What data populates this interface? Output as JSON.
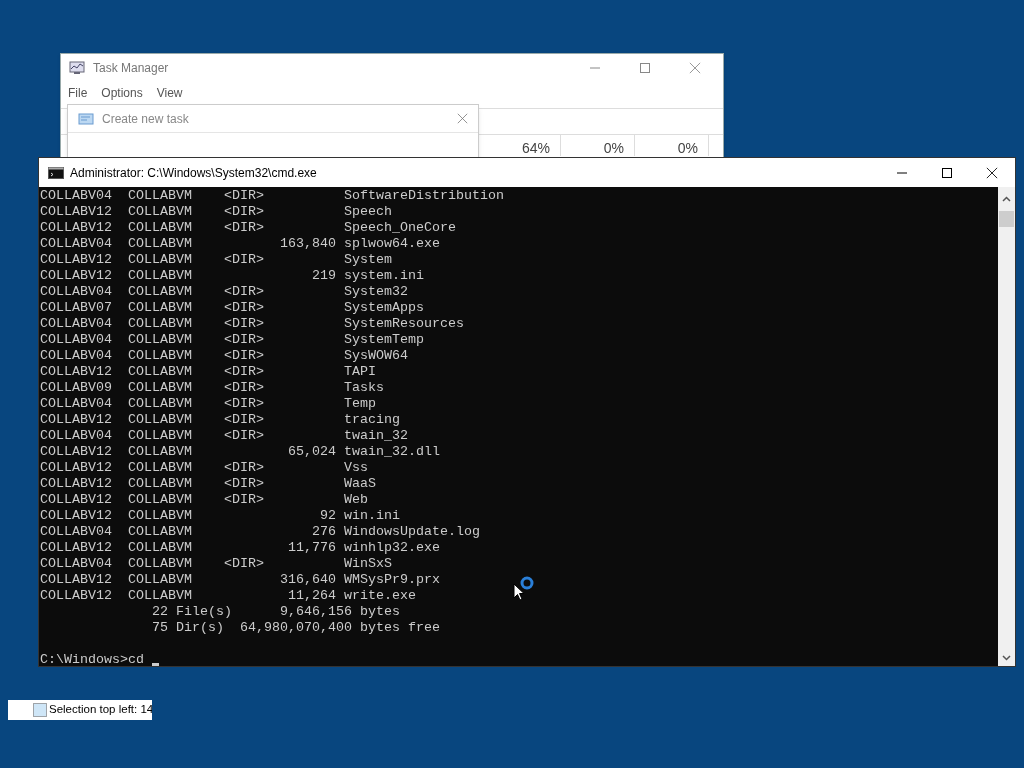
{
  "task_manager": {
    "title": "Task Manager",
    "menu": [
      "File",
      "Options",
      "View"
    ],
    "columns": [
      "64%",
      "0%",
      "0%"
    ]
  },
  "dialog": {
    "title": "Create new task"
  },
  "console": {
    "title": "Administrator: C:\\Windows\\System32\\cmd.exe",
    "lines": [
      "COLLABV04  COLLABVM    <DIR>          SoftwareDistribution",
      "COLLABV12  COLLABVM    <DIR>          Speech",
      "COLLABV12  COLLABVM    <DIR>          Speech_OneCore",
      "COLLABV04  COLLABVM           163,840 splwow64.exe",
      "COLLABV12  COLLABVM    <DIR>          System",
      "COLLABV12  COLLABVM               219 system.ini",
      "COLLABV04  COLLABVM    <DIR>          System32",
      "COLLABV07  COLLABVM    <DIR>          SystemApps",
      "COLLABV04  COLLABVM    <DIR>          SystemResources",
      "COLLABV04  COLLABVM    <DIR>          SystemTemp",
      "COLLABV04  COLLABVM    <DIR>          SysWOW64",
      "COLLABV12  COLLABVM    <DIR>          TAPI",
      "COLLABV09  COLLABVM    <DIR>          Tasks",
      "COLLABV04  COLLABVM    <DIR>          Temp",
      "COLLABV12  COLLABVM    <DIR>          tracing",
      "COLLABV04  COLLABVM    <DIR>          twain_32",
      "COLLABV12  COLLABVM            65,024 twain_32.dll",
      "COLLABV12  COLLABVM    <DIR>          Vss",
      "COLLABV12  COLLABVM    <DIR>          WaaS",
      "COLLABV12  COLLABVM    <DIR>          Web",
      "COLLABV12  COLLABVM                92 win.ini",
      "COLLABV04  COLLABVM               276 WindowsUpdate.log",
      "COLLABV12  COLLABVM            11,776 winhlp32.exe",
      "COLLABV04  COLLABVM    <DIR>          WinSxS",
      "COLLABV12  COLLABVM           316,640 WMSysPr9.prx",
      "COLLABV12  COLLABVM            11,264 write.exe",
      "              22 File(s)      9,646,156 bytes",
      "              75 Dir(s)  64,980,070,400 bytes free"
    ],
    "prompt": "C:\\Windows>cd "
  },
  "status_tip": "Selection top left: 14"
}
